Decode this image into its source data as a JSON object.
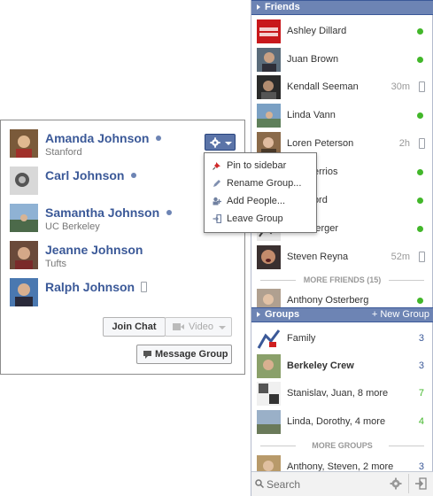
{
  "sidebar": {
    "friends_header": "Friends",
    "friends": [
      {
        "name": "Ashley Dillard",
        "status": "online",
        "idle": ""
      },
      {
        "name": "Juan Brown",
        "status": "online",
        "idle": ""
      },
      {
        "name": "Kendall Seeman",
        "status": "mobile",
        "idle": "30m"
      },
      {
        "name": "Linda Vann",
        "status": "online",
        "idle": ""
      },
      {
        "name": "Loren Peterson",
        "status": "mobile",
        "idle": "2h"
      },
      {
        "name": "Ana Berrios",
        "status": "online",
        "idle": ""
      },
      {
        "name": "Carl Ford",
        "status": "online",
        "idle": ""
      },
      {
        "name": "Stav Berger",
        "status": "online",
        "idle": ""
      },
      {
        "name": "Steven Reyna",
        "status": "mobile",
        "idle": "52m"
      }
    ],
    "more_friends_label": "MORE FRIENDS (15)",
    "more_friends": [
      {
        "name": "Anthony Osterberg",
        "status": "online",
        "idle": ""
      }
    ],
    "groups_header": "Groups",
    "new_group_label": "+ New Group",
    "groups": [
      {
        "name": "Family",
        "count": "3",
        "bold": false,
        "count_color": "blue"
      },
      {
        "name": "Berkeley Crew",
        "count": "3",
        "bold": true,
        "count_color": "blue"
      },
      {
        "name": "Stanislav, Juan, 8 more",
        "count": "7",
        "bold": false,
        "count_color": "green"
      },
      {
        "name": "Linda, Dorothy, 4 more",
        "count": "4",
        "bold": false,
        "count_color": "green"
      }
    ],
    "more_groups_label": "MORE GROUPS",
    "more_groups": [
      {
        "name": "Anthony, Steven, 2 more",
        "count": "3",
        "bold": false,
        "count_color": "blue"
      }
    ],
    "search_placeholder": "Search"
  },
  "group_card": {
    "members": [
      {
        "name": "Amanda Johnson",
        "sub": "Stanford",
        "status": "online"
      },
      {
        "name": "Carl Johnson",
        "sub": "",
        "status": "online"
      },
      {
        "name": "Samantha Johnson",
        "sub": "UC Berkeley",
        "status": "online"
      },
      {
        "name": "Jeanne Johnson",
        "sub": "Tufts",
        "status": "none"
      },
      {
        "name": "Ralph Johnson",
        "sub": "",
        "status": "mobile"
      }
    ],
    "join_chat_label": "Join Chat",
    "video_label": "Video",
    "message_group_label": "Message Group"
  },
  "settings_menu": {
    "items": [
      {
        "label": "Pin to sidebar",
        "icon": "pin-icon"
      },
      {
        "label": "Rename Group...",
        "icon": "pencil-icon"
      },
      {
        "label": "Add People...",
        "icon": "add-person-icon"
      },
      {
        "label": "Leave Group",
        "icon": "leave-icon"
      }
    ]
  },
  "colors": {
    "header_blue": "#6d84b4",
    "link_blue": "#3b5998",
    "online_green": "#42b72a"
  }
}
